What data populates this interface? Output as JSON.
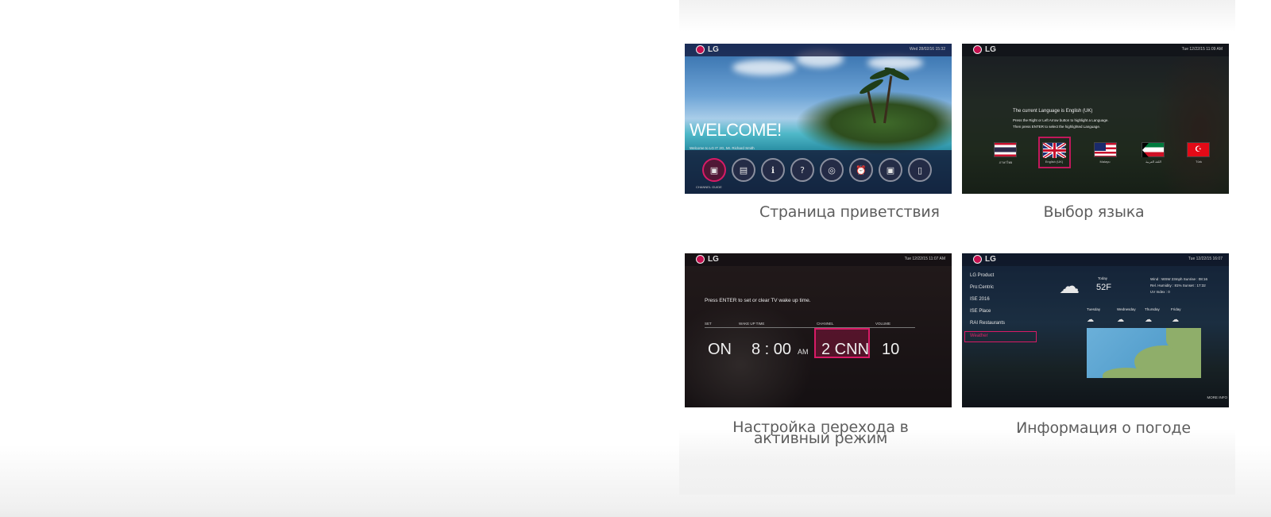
{
  "captions": {
    "welcome": "Страница приветствия",
    "language": "Выбор языка",
    "wakeup_line1": "Настройка перехода в",
    "wakeup_line2": "активный режим",
    "weather": "Информация о погоде"
  },
  "tile_welcome": {
    "logo": "LG",
    "datetime": "Wed 28/02/16 15:32",
    "welcome_text": "WELCOME!",
    "welcome_sub": "Welcome to LG IT 2G, Mr. Richard Smith",
    "active_button_label": "CHANNEL GUIDE",
    "dock_icons": [
      "tv-icon",
      "guide-icon",
      "info-icon",
      "help-icon",
      "globe-icon",
      "alarm-icon",
      "tv-settings-icon",
      "remote-icon"
    ],
    "accent_color": "#d81b66"
  },
  "tile_language": {
    "logo": "LG",
    "logo_sub": "LIVE TENN",
    "datetime": "Tue 12/22/15 11:09 AM",
    "line1": "The current Language is English (UK)",
    "line2": "Press the Right or Left Arrow button to highlight a Language.",
    "line3": "Then press ENTER to select the highlighted Language.",
    "flags": [
      {
        "name": "flag-thailand",
        "label": "ภาษาไทย"
      },
      {
        "name": "flag-uk",
        "label": "English (UK)"
      },
      {
        "name": "flag-malaysia",
        "label": "Malayu"
      },
      {
        "name": "flag-kuwait",
        "label": "اللغة العربية"
      },
      {
        "name": "flag-turkey",
        "label": "Türk"
      }
    ]
  },
  "tile_wakeup": {
    "logo": "LG",
    "logo_sub": "Lifes Good",
    "datetime": "Tue 12/22/15 11:07 AM",
    "prompt": "Press ENTER to set or clear TV wake up time.",
    "head_set": "SET",
    "head_wake": "WAKE UP TIME",
    "head_channel": "CHANNEL",
    "head_volume": "VOLUME",
    "set_value": "ON",
    "time_value": "8 : 00",
    "ampm": "AM",
    "channel_value": "2 CNN",
    "volume_value": "10"
  },
  "tile_weather": {
    "logo": "LG",
    "logo_sub": "LIVE TENN",
    "datetime": "Tue 12/22/15 16:07",
    "menu": [
      "LG Product",
      "Pro:Centric",
      "ISE 2016",
      "ISE Place",
      "RAI Restaurants",
      "Weather"
    ],
    "today_label": "Today",
    "temp": "52F",
    "wind": "Wind : WSW 23mph  Sunrise : 08:16",
    "humidity": "Rel. Humidity : 81%   Sunset : 17:32",
    "uv": "UV Index : 0",
    "forecast_days": [
      "Tuesday",
      "Wednesday",
      "Thursday",
      "Friday"
    ],
    "map_caption": "MORE INFO"
  }
}
